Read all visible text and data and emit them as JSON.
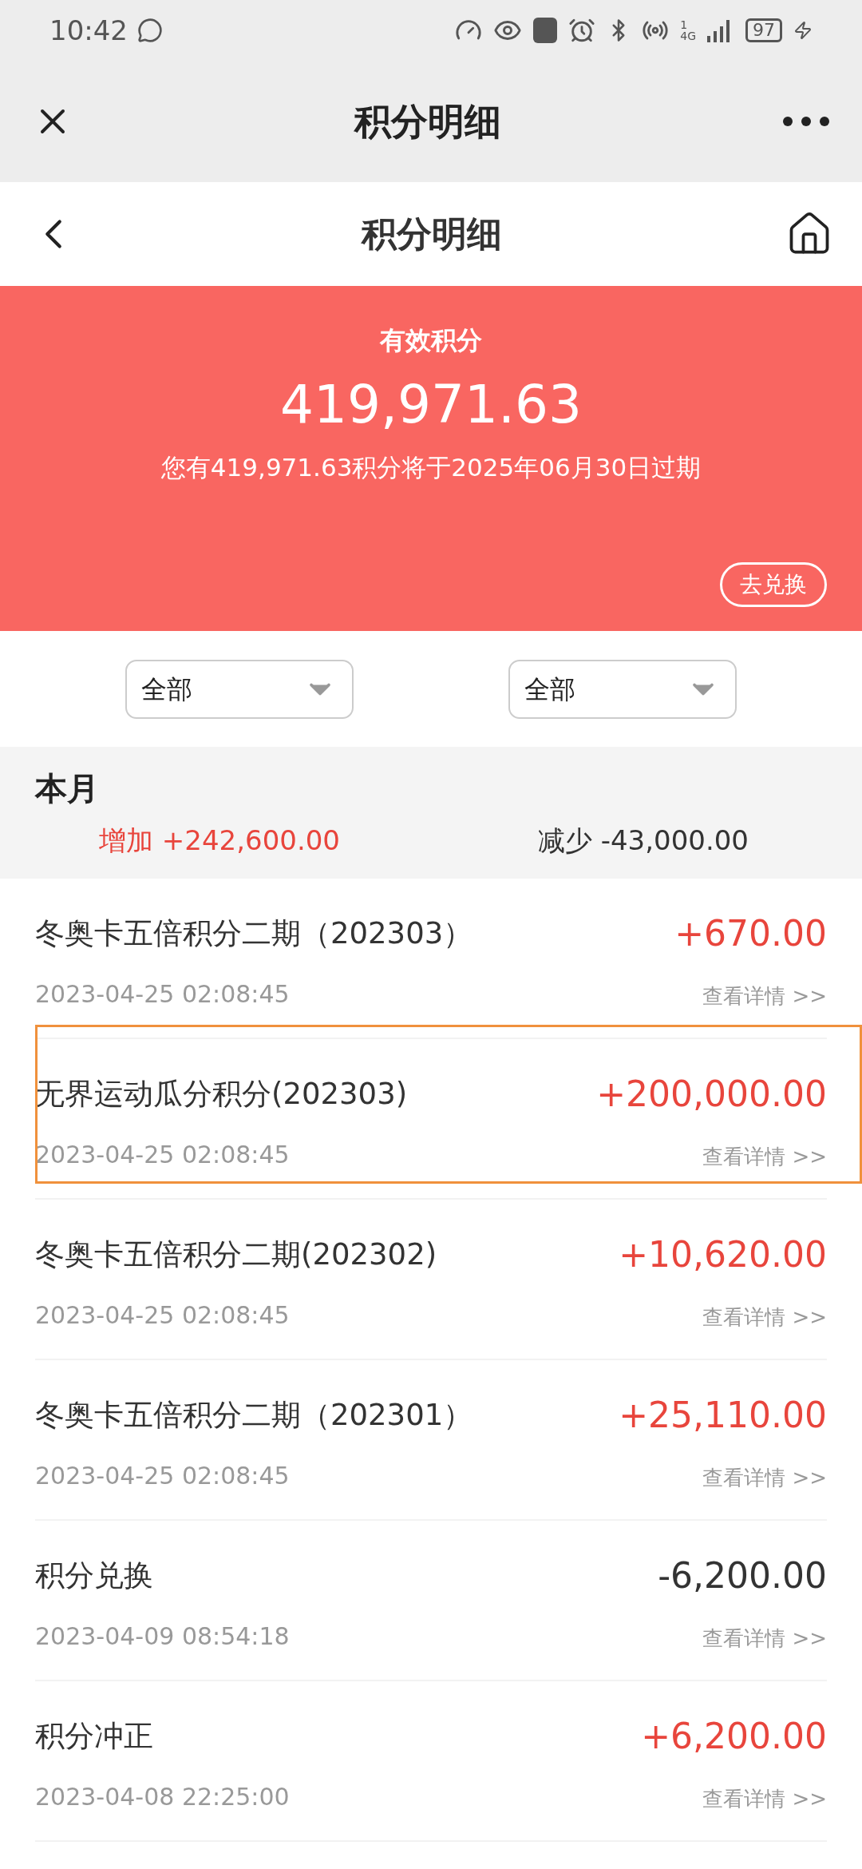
{
  "status_bar": {
    "time": "10:42",
    "network": "4G",
    "sim": "1",
    "battery": "97"
  },
  "top_bar": {
    "title": "积分明细"
  },
  "header": {
    "title": "积分明细"
  },
  "banner": {
    "label": "有效积分",
    "points": "419,971.63",
    "note": "您有419,971.63积分将于2025年06月30日过期",
    "button": "去兑换"
  },
  "filters": [
    {
      "value": "全部"
    },
    {
      "value": "全部"
    }
  ],
  "month": {
    "title": "本月",
    "increase_label": "增加",
    "increase": "+242,600.00",
    "decrease_label": "减少",
    "decrease": "-43,000.00"
  },
  "records": [
    {
      "title": "冬奥卡五倍积分二期（202303）",
      "amount": "+670.00",
      "kind": "credit",
      "time": "2023-04-25 02:08:45",
      "link": "查看详情 >>",
      "highlighted": false
    },
    {
      "title": "无界运动瓜分积分(202303)",
      "amount": "+200,000.00",
      "kind": "credit",
      "time": "2023-04-25 02:08:45",
      "link": "查看详情 >>",
      "highlighted": true
    },
    {
      "title": "冬奥卡五倍积分二期(202302)",
      "amount": "+10,620.00",
      "kind": "credit",
      "time": "2023-04-25 02:08:45",
      "link": "查看详情 >>",
      "highlighted": false
    },
    {
      "title": "冬奥卡五倍积分二期（202301）",
      "amount": "+25,110.00",
      "kind": "credit",
      "time": "2023-04-25 02:08:45",
      "link": "查看详情 >>",
      "highlighted": false
    },
    {
      "title": "积分兑换",
      "amount": "-6,200.00",
      "kind": "debit",
      "time": "2023-04-09 08:54:18",
      "link": "查看详情 >>",
      "highlighted": false
    },
    {
      "title": "积分冲正",
      "amount": "+6,200.00",
      "kind": "credit",
      "time": "2023-04-08 22:25:00",
      "link": "查看详情 >>",
      "highlighted": false
    }
  ]
}
